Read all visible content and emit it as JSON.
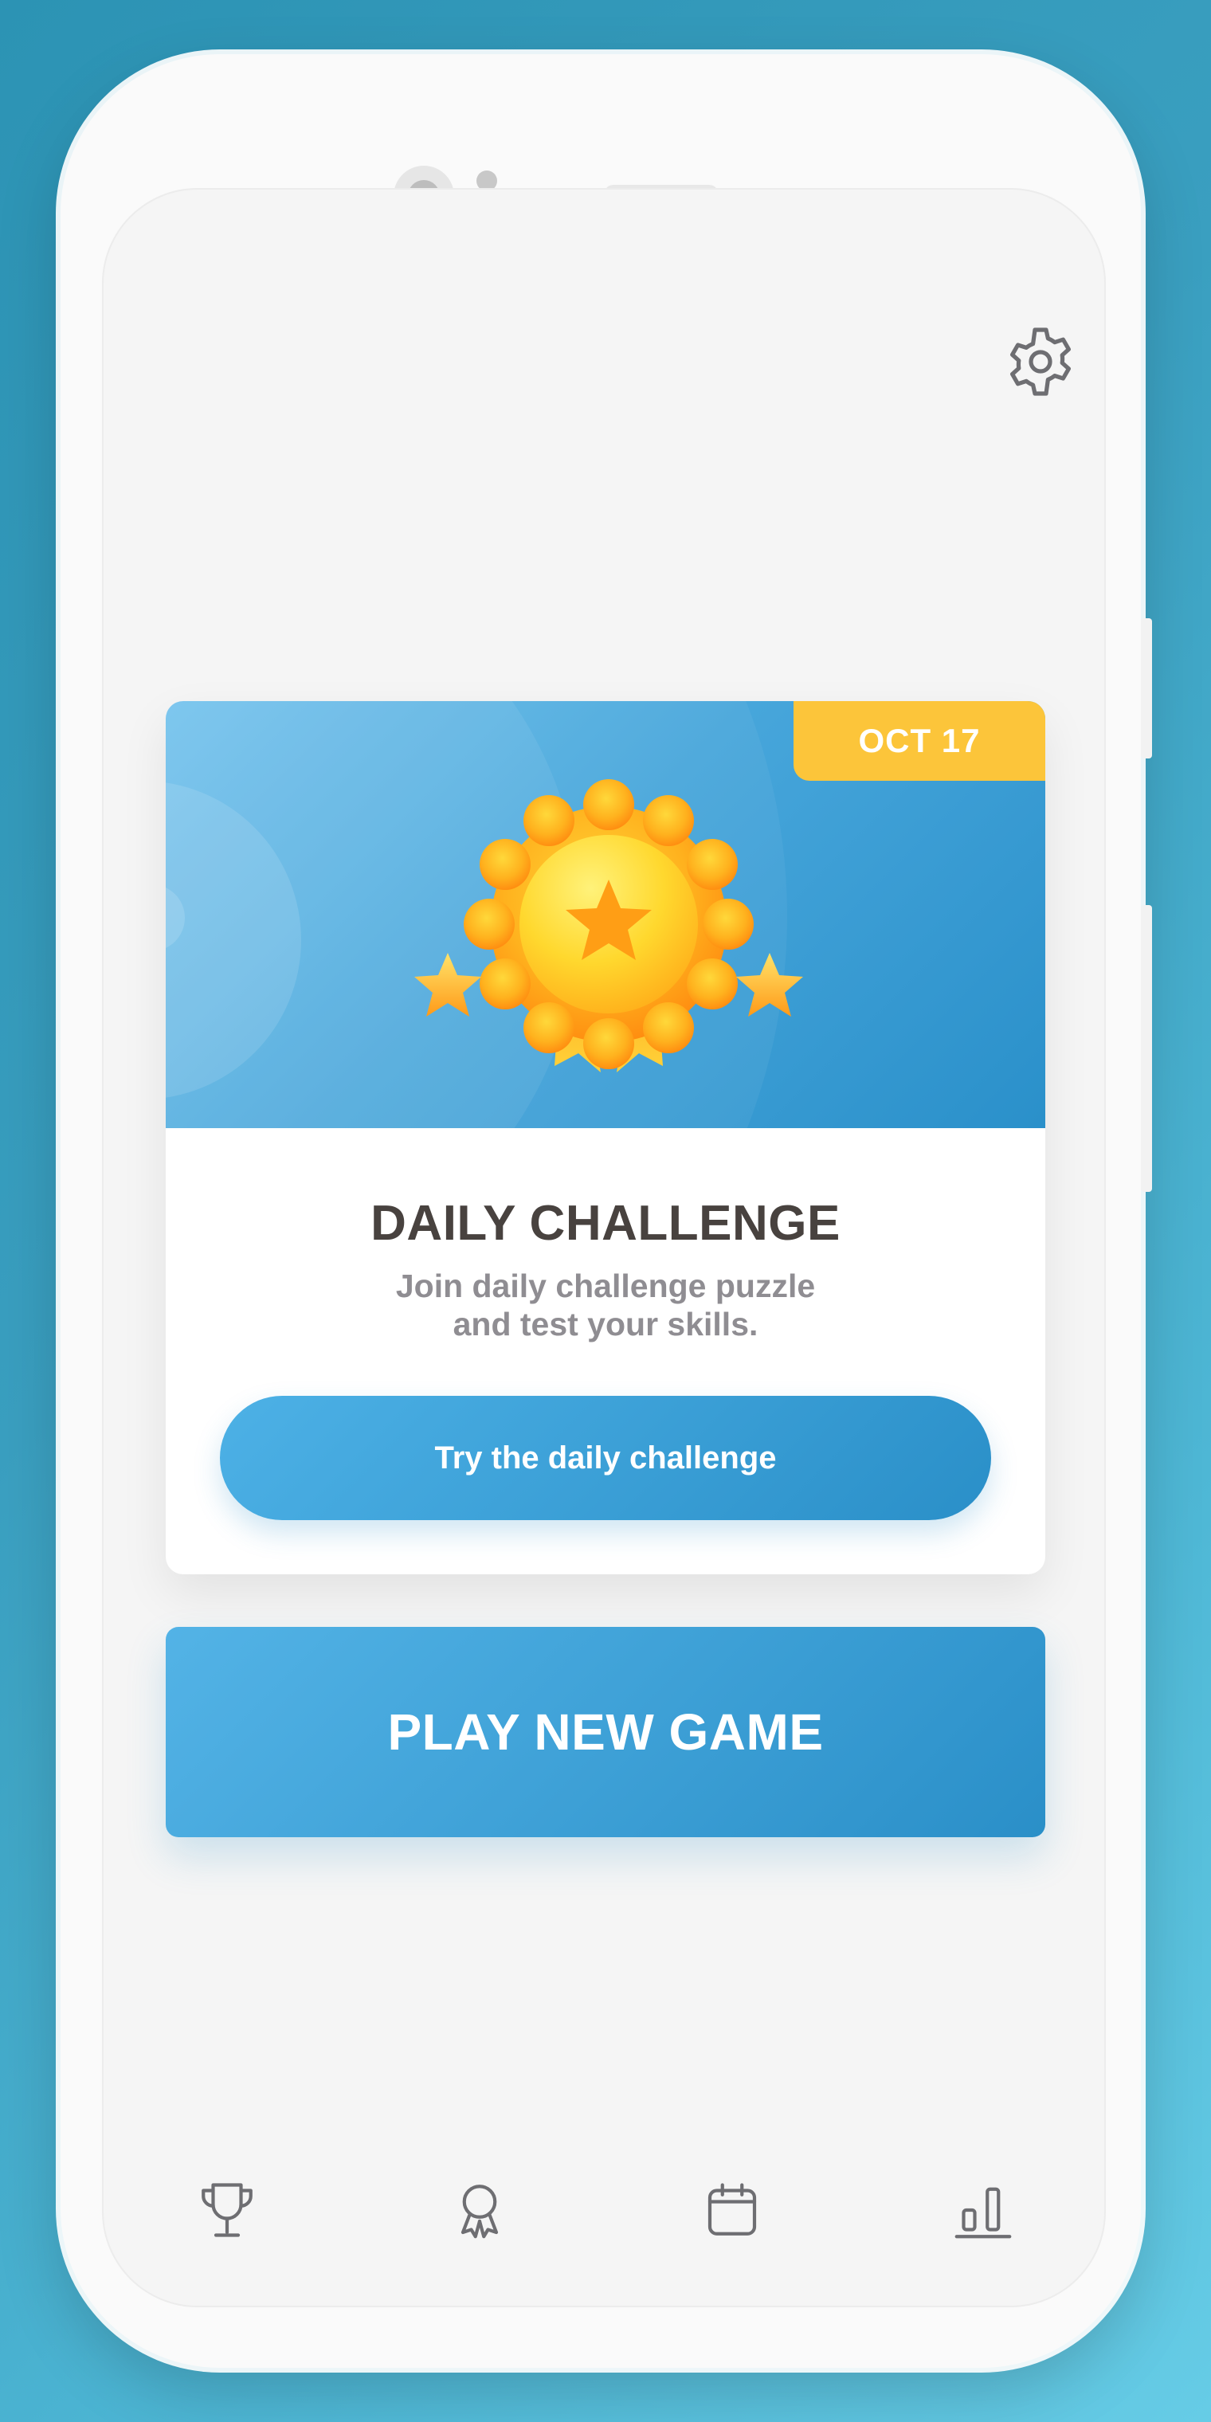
{
  "colors": {
    "accent": "#3a9fd6",
    "badge": "#fcc53a",
    "title_text": "#48423f",
    "muted_text": "#8f8d92",
    "icon": "#6e6e72"
  },
  "header": {
    "settings_icon": "gear-icon"
  },
  "daily_card": {
    "date_badge": "OCT 17",
    "illustration": "medal-with-stars",
    "title": "DAILY CHALLENGE",
    "description_line1": "Join daily challenge puzzle",
    "description_line2": "and test your skills.",
    "cta_label": "Try the daily challenge"
  },
  "play_button": {
    "label": "PLAY NEW GAME"
  },
  "bottom_nav": {
    "items": [
      {
        "icon": "trophy-icon"
      },
      {
        "icon": "award-icon"
      },
      {
        "icon": "calendar-icon"
      },
      {
        "icon": "stats-icon"
      }
    ]
  }
}
